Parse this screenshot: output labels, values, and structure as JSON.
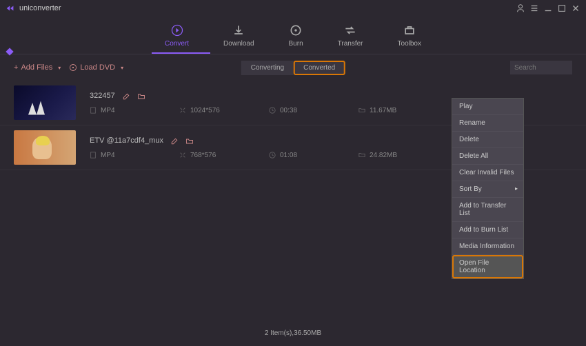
{
  "app": {
    "title": "uniconverter"
  },
  "tabs": {
    "convert": "Convert",
    "download": "Download",
    "burn": "Burn",
    "transfer": "Transfer",
    "toolbox": "Toolbox"
  },
  "actions": {
    "add_files": "Add Files",
    "load_dvd": "Load DVD"
  },
  "center_tabs": {
    "converting": "Converting",
    "converted": "Converted"
  },
  "search": {
    "placeholder": "Search"
  },
  "files": [
    {
      "name": "322457",
      "format": "MP4",
      "resolution": "1024*576",
      "duration": "00:38",
      "size": "11.67MB"
    },
    {
      "name": "ETV @11a7cdf4_mux",
      "format": "MP4",
      "resolution": "768*576",
      "duration": "01:08",
      "size": "24.82MB"
    }
  ],
  "context_menu": {
    "play": "Play",
    "rename": "Rename",
    "delete": "Delete",
    "delete_all": "Delete All",
    "clear_invalid": "Clear Invalid Files",
    "sort_by": "Sort By",
    "add_transfer": "Add to Transfer List",
    "add_burn": "Add to Burn List",
    "media_info": "Media Information",
    "open_location": "Open File Location"
  },
  "status": "2 Item(s),36.50MB"
}
